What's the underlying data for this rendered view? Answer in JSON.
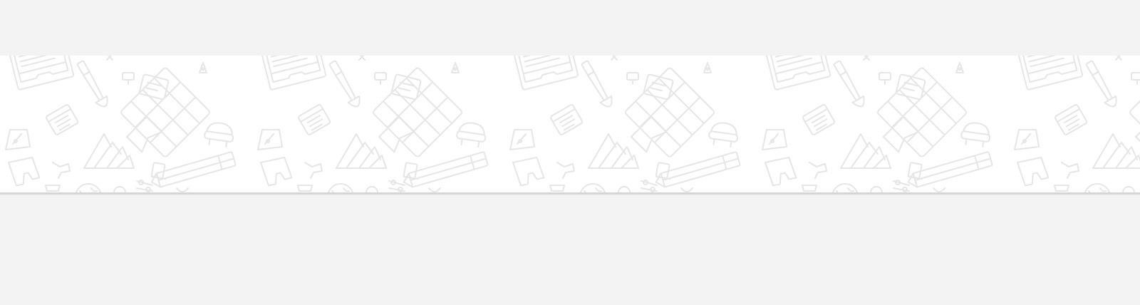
{
  "page": {
    "background_color": "#f3f3f3",
    "banner_background_color": "#ffffff",
    "doodle_color": "#e6e6e6",
    "divider_color": "#d6d6d6"
  },
  "banner": {
    "pattern_icons": [
      "document-icon",
      "paintbrush-icon",
      "piano-keys-icon",
      "pen-nib-icon",
      "calendar-icon",
      "pencil-icon",
      "bookmark-icon",
      "globe-icon",
      "watch-icon",
      "tshirt-icon",
      "stool-icon",
      "sticky-note-icon",
      "mountains-icon",
      "sliders-icon"
    ]
  }
}
